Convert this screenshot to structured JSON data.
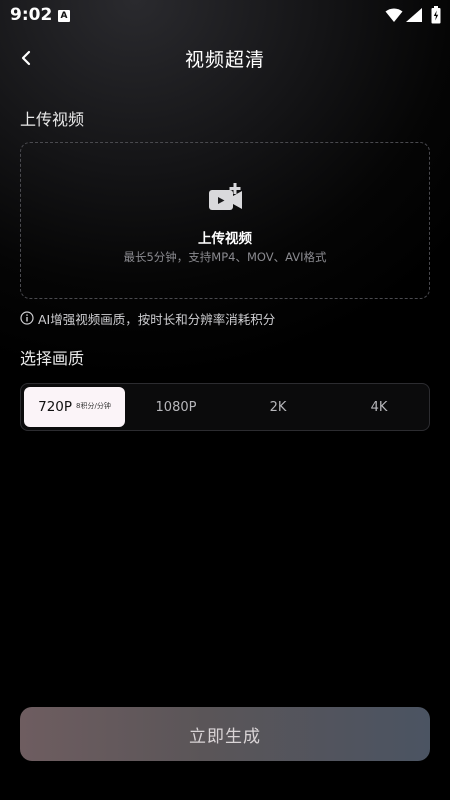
{
  "status_bar": {
    "time": "9:02",
    "app_icon_letter": "A",
    "icons": [
      "wifi-icon",
      "signal-icon",
      "battery-icon"
    ]
  },
  "header": {
    "title": "视频超清",
    "back_icon": "chevron-left-icon"
  },
  "upload": {
    "section_title": "上传视频",
    "label": "上传视频",
    "hint": "最长5分钟，支持MP4、MOV、AVI格式",
    "icon": "video-add-icon"
  },
  "info": {
    "icon": "info-icon",
    "text": "AI增强视频画质，按时长和分辨率消耗积分"
  },
  "quality": {
    "section_title": "选择画质",
    "selected_index": 0,
    "options": [
      {
        "label": "720P",
        "sub": "8积分/分钟"
      },
      {
        "label": "1080P",
        "sub": ""
      },
      {
        "label": "2K",
        "sub": ""
      },
      {
        "label": "4K",
        "sub": ""
      }
    ]
  },
  "action": {
    "generate_label": "立即生成"
  },
  "colors": {
    "background": "#000000",
    "selected_option_bg": "#fbf4f8",
    "button_gradient_start": "#6e5d60",
    "button_gradient_end": "#4b5462"
  }
}
